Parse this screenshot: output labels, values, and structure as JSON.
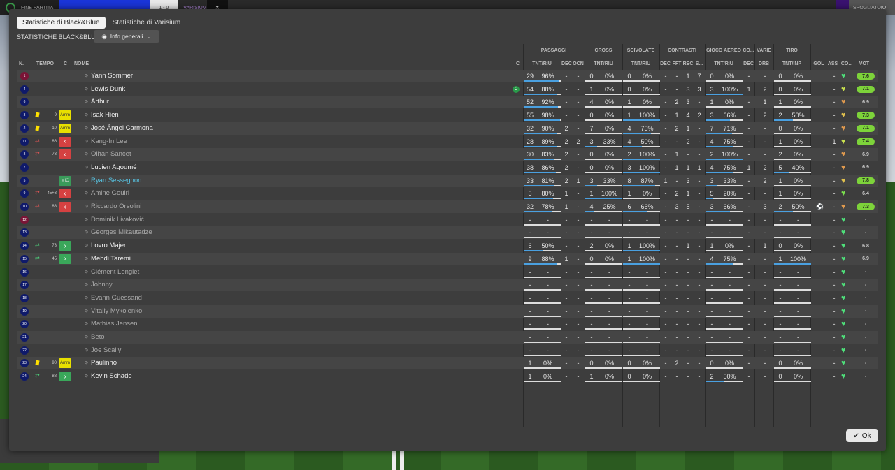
{
  "topbar": {
    "left_label": "FINE PARTITA",
    "score_left": "1 - 0",
    "team_right": "VARISIUM",
    "right_label": "SPOGLIATOIO"
  },
  "tabs": [
    {
      "label": "Statistiche di Black&Blue",
      "active": true
    },
    {
      "label": "Statistiche di Varisium",
      "active": false
    }
  ],
  "subtitle": "STATISTICHE BLACK&BLUE",
  "dropdown": {
    "label": "Info generali"
  },
  "groups": {
    "passaggi": "PASSAGGI",
    "cross": "CROSS",
    "scivolate": "SCIVOLATE",
    "contrasti": "CONTRASTI",
    "gioco_aereo": "GIOCO AEREO",
    "co": "CO...",
    "varie": "VARIE",
    "tiro": "TIRO"
  },
  "columns": {
    "n": "N.",
    "tempo": "TEMPO",
    "c": "C",
    "nome": "NOME",
    "c2": "C",
    "pass": "TNT/RIU",
    "dec": "DEC",
    "ocn": "OCN",
    "cross": "TNT/RIU",
    "sciv": "TNT/RIU",
    "dec2": "DEC",
    "fft": "FFT",
    "rec": "REC",
    "s": "S...",
    "aereo": "TNT/RIU",
    "dec3": "DEC",
    "drb": "DRB",
    "tiro": "TNT/INP",
    "gol": "GOL",
    "ass": "ASS",
    "co2": "CO...",
    "vot": "VOT"
  },
  "players": [
    {
      "num": "1",
      "gk": true,
      "yc": false,
      "swap": "",
      "time": "",
      "role": "",
      "name": "Yann Sommer",
      "dim": false,
      "hl": false,
      "cap": false,
      "pass": "29",
      "passp": "96%",
      "pf": 0.96,
      "dec": "-",
      "ocn": "-",
      "cross": "0",
      "crossp": "0%",
      "cf": 0,
      "sciv": "0",
      "scivp": "0%",
      "sf": 0,
      "cdec": "-",
      "fft": "-",
      "rec": "1",
      "s": "7",
      "aer": "0",
      "aerp": "0%",
      "af": 0,
      "adec": "-",
      "drb": "-",
      "tiro": "0",
      "tirop": "0%",
      "tf": 0,
      "gol": "",
      "ass": "-",
      "heart": "#4ee07a",
      "vot": "7.6",
      "vg": true
    },
    {
      "num": "4",
      "gk": false,
      "yc": false,
      "swap": "",
      "time": "",
      "role": "",
      "name": "Lewis Dunk",
      "dim": false,
      "hl": false,
      "cap": true,
      "pass": "54",
      "passp": "88%",
      "pf": 0.88,
      "dec": "-",
      "ocn": "-",
      "cross": "1",
      "crossp": "0%",
      "cf": 0,
      "sciv": "0",
      "scivp": "0%",
      "sf": 0,
      "cdec": "-",
      "fft": "-",
      "rec": "3",
      "s": "3",
      "aer": "3",
      "aerp": "100%",
      "af": 1,
      "adec": "1",
      "drb": "2",
      "tiro": "0",
      "tirop": "0%",
      "tf": 0,
      "gol": "",
      "ass": "-",
      "heart": "#c8e04e",
      "vot": "7.1",
      "vg": true
    },
    {
      "num": "6",
      "gk": false,
      "yc": false,
      "swap": "",
      "time": "",
      "role": "",
      "name": "Arthur",
      "dim": false,
      "hl": false,
      "cap": false,
      "pass": "52",
      "passp": "92%",
      "pf": 0.92,
      "dec": "-",
      "ocn": "-",
      "cross": "4",
      "crossp": "0%",
      "cf": 0,
      "sciv": "1",
      "scivp": "0%",
      "sf": 0,
      "cdec": "-",
      "fft": "2",
      "rec": "3",
      "s": "-",
      "aer": "1",
      "aerp": "0%",
      "af": 0,
      "adec": "-",
      "drb": "1",
      "tiro": "1",
      "tirop": "0%",
      "tf": 0,
      "gol": "",
      "ass": "-",
      "heart": "#e09a4e",
      "vot": "6.9",
      "vg": false
    },
    {
      "num": "3",
      "gk": false,
      "yc": true,
      "swap": "",
      "time": "9",
      "role": "Amm",
      "name": "Isak Hien",
      "dim": false,
      "hl": false,
      "cap": false,
      "pass": "55",
      "passp": "98%",
      "pf": 0.98,
      "dec": "-",
      "ocn": "-",
      "cross": "0",
      "crossp": "0%",
      "cf": 0,
      "sciv": "1",
      "scivp": "100%",
      "sf": 1,
      "cdec": "-",
      "fft": "1",
      "rec": "4",
      "s": "2",
      "aer": "3",
      "aerp": "66%",
      "af": 0.66,
      "adec": "-",
      "drb": "2",
      "tiro": "2",
      "tirop": "50%",
      "tf": 0.5,
      "gol": "",
      "ass": "-",
      "heart": "#e0c04e",
      "vot": "7.3",
      "vg": true
    },
    {
      "num": "2",
      "gk": false,
      "yc": true,
      "swap": "",
      "time": "10",
      "role": "Amm",
      "name": "José Ángel Carmona",
      "dim": false,
      "hl": false,
      "cap": false,
      "pass": "32",
      "passp": "90%",
      "pf": 0.9,
      "dec": "2",
      "ocn": "-",
      "cross": "7",
      "crossp": "0%",
      "cf": 0,
      "sciv": "4",
      "scivp": "75%",
      "sf": 0.75,
      "cdec": "-",
      "fft": "2",
      "rec": "1",
      "s": "-",
      "aer": "7",
      "aerp": "71%",
      "af": 0.71,
      "adec": "-",
      "drb": "-",
      "tiro": "0",
      "tirop": "0%",
      "tf": 0,
      "gol": "",
      "ass": "-",
      "heart": "#e09a4e",
      "vot": "7.1",
      "vg": true
    },
    {
      "num": "11",
      "gk": false,
      "yc": false,
      "swap": "r",
      "time": "86",
      "role": "out",
      "name": "Kang-In Lee",
      "dim": true,
      "hl": false,
      "cap": false,
      "pass": "28",
      "passp": "89%",
      "pf": 0.89,
      "dec": "2",
      "ocn": "2",
      "cross": "3",
      "crossp": "33%",
      "cf": 0.33,
      "sciv": "4",
      "scivp": "50%",
      "sf": 0.5,
      "cdec": "-",
      "fft": "-",
      "rec": "2",
      "s": "-",
      "aer": "4",
      "aerp": "75%",
      "af": 0.75,
      "adec": "-",
      "drb": "-",
      "tiro": "1",
      "tirop": "0%",
      "tf": 0,
      "gol": "",
      "ass": "1",
      "heart": "#c8e04e",
      "vot": "7.4",
      "vg": true
    },
    {
      "num": "8",
      "gk": false,
      "yc": false,
      "swap": "r",
      "time": "73",
      "role": "out",
      "name": "Oihan Sancet",
      "dim": true,
      "hl": false,
      "cap": false,
      "pass": "30",
      "passp": "83%",
      "pf": 0.83,
      "dec": "2",
      "ocn": "-",
      "cross": "0",
      "crossp": "0%",
      "cf": 0,
      "sciv": "2",
      "scivp": "100%",
      "sf": 1,
      "cdec": "-",
      "fft": "1",
      "rec": "-",
      "s": "-",
      "aer": "2",
      "aerp": "100%",
      "af": 1,
      "adec": "-",
      "drb": "-",
      "tiro": "2",
      "tirop": "0%",
      "tf": 0,
      "gol": "",
      "ass": "-",
      "heart": "#e09a4e",
      "vot": "6.9",
      "vg": false
    },
    {
      "num": "7",
      "gk": false,
      "yc": false,
      "swap": "",
      "time": "",
      "role": "",
      "name": "Lucien Agoumé",
      "dim": false,
      "hl": false,
      "cap": false,
      "pass": "38",
      "passp": "86%",
      "pf": 0.86,
      "dec": "2",
      "ocn": "-",
      "cross": "0",
      "crossp": "0%",
      "cf": 0,
      "sciv": "3",
      "scivp": "100%",
      "sf": 1,
      "cdec": "-",
      "fft": "1",
      "rec": "1",
      "s": "1",
      "aer": "4",
      "aerp": "75%",
      "af": 0.75,
      "adec": "1",
      "drb": "2",
      "tiro": "5",
      "tirop": "40%",
      "tf": 0.4,
      "gol": "",
      "ass": "-",
      "heart": "#e09a4e",
      "vot": "6.9",
      "vg": false
    },
    {
      "num": "5",
      "gk": false,
      "yc": false,
      "swap": "",
      "time": "",
      "role": "MIC",
      "name": "Ryan Sessegnon",
      "dim": false,
      "hl": true,
      "cap": false,
      "pass": "33",
      "passp": "81%",
      "pf": 0.81,
      "dec": "2",
      "ocn": "1",
      "cross": "3",
      "crossp": "33%",
      "cf": 0.33,
      "sciv": "8",
      "scivp": "87%",
      "sf": 0.87,
      "cdec": "1",
      "fft": "-",
      "rec": "3",
      "s": "-",
      "aer": "3",
      "aerp": "33%",
      "af": 0.33,
      "adec": "-",
      "drb": "2",
      "tiro": "1",
      "tirop": "0%",
      "tf": 0,
      "gol": "",
      "ass": "-",
      "heart": "#e0c04e",
      "vot": "7.8",
      "vg": true
    },
    {
      "num": "9",
      "gk": false,
      "yc": false,
      "swap": "r",
      "time": "45+3",
      "role": "out",
      "name": "Amine Gouiri",
      "dim": true,
      "hl": false,
      "cap": false,
      "pass": "5",
      "passp": "80%",
      "pf": 0.8,
      "dec": "1",
      "ocn": "-",
      "cross": "1",
      "crossp": "100%",
      "cf": 1,
      "sciv": "1",
      "scivp": "0%",
      "sf": 0,
      "cdec": "-",
      "fft": "2",
      "rec": "1",
      "s": "-",
      "aer": "5",
      "aerp": "20%",
      "af": 0.2,
      "adec": "-",
      "drb": "-",
      "tiro": "1",
      "tirop": "0%",
      "tf": 0,
      "gol": "",
      "ass": "-",
      "heart": "#7ae04e",
      "vot": "6.4",
      "vg": false
    },
    {
      "num": "10",
      "gk": false,
      "yc": false,
      "swap": "r",
      "time": "88",
      "role": "out",
      "name": "Riccardo Orsolini",
      "dim": true,
      "hl": false,
      "cap": false,
      "pass": "32",
      "passp": "78%",
      "pf": 0.78,
      "dec": "1",
      "ocn": "-",
      "cross": "4",
      "crossp": "25%",
      "cf": 0.25,
      "sciv": "6",
      "scivp": "66%",
      "sf": 0.66,
      "cdec": "-",
      "fft": "3",
      "rec": "5",
      "s": "-",
      "aer": "3",
      "aerp": "66%",
      "af": 0.66,
      "adec": "-",
      "drb": "3",
      "tiro": "2",
      "tirop": "50%",
      "tf": 0.5,
      "gol": "⚽",
      "ass": "-",
      "heart": "#e09a4e",
      "vot": "7.3",
      "vg": true
    },
    {
      "num": "12",
      "gk": true,
      "yc": false,
      "swap": "",
      "time": "",
      "role": "",
      "name": "Dominik Livaković",
      "dim": true,
      "hl": false,
      "cap": false,
      "pass": "-",
      "passp": "-",
      "pf": 0,
      "dec": "-",
      "ocn": "-",
      "cross": "-",
      "crossp": "-",
      "cf": 0,
      "sciv": "-",
      "scivp": "-",
      "sf": 0,
      "cdec": "-",
      "fft": "-",
      "rec": "-",
      "s": "-",
      "aer": "-",
      "aerp": "-",
      "af": 0,
      "adec": "-",
      "drb": "-",
      "tiro": "-",
      "tirop": "-",
      "tf": 0,
      "gol": "",
      "ass": "-",
      "heart": "#4ee07a",
      "vot": "-",
      "vg": false
    },
    {
      "num": "13",
      "gk": false,
      "yc": false,
      "swap": "",
      "time": "",
      "role": "",
      "name": "Georges Mikautadze",
      "dim": true,
      "hl": false,
      "cap": false,
      "pass": "-",
      "passp": "-",
      "pf": 0,
      "dec": "-",
      "ocn": "-",
      "cross": "-",
      "crossp": "-",
      "cf": 0,
      "sciv": "-",
      "scivp": "-",
      "sf": 0,
      "cdec": "-",
      "fft": "-",
      "rec": "-",
      "s": "-",
      "aer": "-",
      "aerp": "-",
      "af": 0,
      "adec": "-",
      "drb": "-",
      "tiro": "-",
      "tirop": "-",
      "tf": 0,
      "gol": "",
      "ass": "-",
      "heart": "#4ee07a",
      "vot": "-",
      "vg": false
    },
    {
      "num": "14",
      "gk": false,
      "yc": false,
      "swap": "g",
      "time": "73",
      "role": "in",
      "name": "Lovro Majer",
      "dim": false,
      "hl": false,
      "cap": false,
      "pass": "6",
      "passp": "50%",
      "pf": 0.5,
      "dec": "-",
      "ocn": "-",
      "cross": "2",
      "crossp": "0%",
      "cf": 0,
      "sciv": "1",
      "scivp": "100%",
      "sf": 1,
      "cdec": "-",
      "fft": "-",
      "rec": "1",
      "s": "-",
      "aer": "1",
      "aerp": "0%",
      "af": 0,
      "adec": "-",
      "drb": "1",
      "tiro": "0",
      "tirop": "0%",
      "tf": 0,
      "gol": "",
      "ass": "-",
      "heart": "#4ee07a",
      "vot": "6.8",
      "vg": false
    },
    {
      "num": "15",
      "gk": false,
      "yc": false,
      "swap": "g",
      "time": "45",
      "role": "in",
      "name": "Mehdi Taremi",
      "dim": false,
      "hl": false,
      "cap": false,
      "pass": "9",
      "passp": "88%",
      "pf": 0.88,
      "dec": "1",
      "ocn": "-",
      "cross": "0",
      "crossp": "0%",
      "cf": 0,
      "sciv": "1",
      "scivp": "100%",
      "sf": 1,
      "cdec": "-",
      "fft": "-",
      "rec": "-",
      "s": "-",
      "aer": "4",
      "aerp": "75%",
      "af": 0.75,
      "adec": "-",
      "drb": "-",
      "tiro": "1",
      "tirop": "100%",
      "tf": 1,
      "gol": "",
      "ass": "-",
      "heart": "#4ee07a",
      "vot": "6.9",
      "vg": false
    },
    {
      "num": "16",
      "gk": false,
      "yc": false,
      "swap": "",
      "time": "",
      "role": "",
      "name": "Clément Lenglet",
      "dim": true,
      "hl": false,
      "cap": false,
      "pass": "-",
      "passp": "-",
      "pf": 0,
      "dec": "-",
      "ocn": "-",
      "cross": "-",
      "crossp": "-",
      "cf": 0,
      "sciv": "-",
      "scivp": "-",
      "sf": 0,
      "cdec": "-",
      "fft": "-",
      "rec": "-",
      "s": "-",
      "aer": "-",
      "aerp": "-",
      "af": 0,
      "adec": "-",
      "drb": "-",
      "tiro": "-",
      "tirop": "-",
      "tf": 0,
      "gol": "",
      "ass": "-",
      "heart": "#4ee07a",
      "vot": "-",
      "vg": false
    },
    {
      "num": "17",
      "gk": false,
      "yc": false,
      "swap": "",
      "time": "",
      "role": "",
      "name": "Johnny",
      "dim": true,
      "hl": false,
      "cap": false,
      "pass": "-",
      "passp": "-",
      "pf": 0,
      "dec": "-",
      "ocn": "-",
      "cross": "-",
      "crossp": "-",
      "cf": 0,
      "sciv": "-",
      "scivp": "-",
      "sf": 0,
      "cdec": "-",
      "fft": "-",
      "rec": "-",
      "s": "-",
      "aer": "-",
      "aerp": "-",
      "af": 0,
      "adec": "-",
      "drb": "-",
      "tiro": "-",
      "tirop": "-",
      "tf": 0,
      "gol": "",
      "ass": "-",
      "heart": "#4ee07a",
      "vot": "-",
      "vg": false
    },
    {
      "num": "18",
      "gk": false,
      "yc": false,
      "swap": "",
      "time": "",
      "role": "",
      "name": "Evann Guessand",
      "dim": true,
      "hl": false,
      "cap": false,
      "pass": "-",
      "passp": "-",
      "pf": 0,
      "dec": "-",
      "ocn": "-",
      "cross": "-",
      "crossp": "-",
      "cf": 0,
      "sciv": "-",
      "scivp": "-",
      "sf": 0,
      "cdec": "-",
      "fft": "-",
      "rec": "-",
      "s": "-",
      "aer": "-",
      "aerp": "-",
      "af": 0,
      "adec": "-",
      "drb": "-",
      "tiro": "-",
      "tirop": "-",
      "tf": 0,
      "gol": "",
      "ass": "-",
      "heart": "#4ee07a",
      "vot": "-",
      "vg": false
    },
    {
      "num": "19",
      "gk": false,
      "yc": false,
      "swap": "",
      "time": "",
      "role": "",
      "name": "Vitaliy Mykolenko",
      "dim": true,
      "hl": false,
      "cap": false,
      "pass": "-",
      "passp": "-",
      "pf": 0,
      "dec": "-",
      "ocn": "-",
      "cross": "-",
      "crossp": "-",
      "cf": 0,
      "sciv": "-",
      "scivp": "-",
      "sf": 0,
      "cdec": "-",
      "fft": "-",
      "rec": "-",
      "s": "-",
      "aer": "-",
      "aerp": "-",
      "af": 0,
      "adec": "-",
      "drb": "-",
      "tiro": "-",
      "tirop": "-",
      "tf": 0,
      "gol": "",
      "ass": "-",
      "heart": "#4ee07a",
      "vot": "-",
      "vg": false
    },
    {
      "num": "20",
      "gk": false,
      "yc": false,
      "swap": "",
      "time": "",
      "role": "",
      "name": "Mathias Jensen",
      "dim": true,
      "hl": false,
      "cap": false,
      "pass": "-",
      "passp": "-",
      "pf": 0,
      "dec": "-",
      "ocn": "-",
      "cross": "-",
      "crossp": "-",
      "cf": 0,
      "sciv": "-",
      "scivp": "-",
      "sf": 0,
      "cdec": "-",
      "fft": "-",
      "rec": "-",
      "s": "-",
      "aer": "-",
      "aerp": "-",
      "af": 0,
      "adec": "-",
      "drb": "-",
      "tiro": "-",
      "tirop": "-",
      "tf": 0,
      "gol": "",
      "ass": "-",
      "heart": "#4ee07a",
      "vot": "-",
      "vg": false
    },
    {
      "num": "21",
      "gk": false,
      "yc": false,
      "swap": "",
      "time": "",
      "role": "",
      "name": "Beto",
      "dim": true,
      "hl": false,
      "cap": false,
      "pass": "-",
      "passp": "-",
      "pf": 0,
      "dec": "-",
      "ocn": "-",
      "cross": "-",
      "crossp": "-",
      "cf": 0,
      "sciv": "-",
      "scivp": "-",
      "sf": 0,
      "cdec": "-",
      "fft": "-",
      "rec": "-",
      "s": "-",
      "aer": "-",
      "aerp": "-",
      "af": 0,
      "adec": "-",
      "drb": "-",
      "tiro": "-",
      "tirop": "-",
      "tf": 0,
      "gol": "",
      "ass": "-",
      "heart": "#4ee07a",
      "vot": "-",
      "vg": false
    },
    {
      "num": "22",
      "gk": false,
      "yc": false,
      "swap": "",
      "time": "",
      "role": "",
      "name": "Joe Scally",
      "dim": true,
      "hl": false,
      "cap": false,
      "pass": "-",
      "passp": "-",
      "pf": 0,
      "dec": "-",
      "ocn": "-",
      "cross": "-",
      "crossp": "-",
      "cf": 0,
      "sciv": "-",
      "scivp": "-",
      "sf": 0,
      "cdec": "-",
      "fft": "-",
      "rec": "-",
      "s": "-",
      "aer": "-",
      "aerp": "-",
      "af": 0,
      "adec": "-",
      "drb": "-",
      "tiro": "-",
      "tirop": "-",
      "tf": 0,
      "gol": "",
      "ass": "-",
      "heart": "#4ee07a",
      "vot": "-",
      "vg": false
    },
    {
      "num": "23",
      "gk": false,
      "yc": true,
      "swap": "",
      "time": "90",
      "role": "Amm",
      "name": "Paulinho",
      "dim": false,
      "hl": false,
      "cap": false,
      "pass": "1",
      "passp": "0%",
      "pf": 0,
      "dec": "-",
      "ocn": "-",
      "cross": "0",
      "crossp": "0%",
      "cf": 0,
      "sciv": "0",
      "scivp": "0%",
      "sf": 0,
      "cdec": "-",
      "fft": "2",
      "rec": "-",
      "s": "-",
      "aer": "0",
      "aerp": "0%",
      "af": 0,
      "adec": "-",
      "drb": "-",
      "tiro": "0",
      "tirop": "0%",
      "tf": 0,
      "gol": "",
      "ass": "-",
      "heart": "#4ee07a",
      "vot": "-",
      "vg": false
    },
    {
      "num": "24",
      "gk": false,
      "yc": false,
      "swap": "g",
      "time": "88",
      "role": "in",
      "name": "Kevin Schade",
      "dim": false,
      "hl": false,
      "cap": false,
      "pass": "1",
      "passp": "0%",
      "pf": 0,
      "dec": "-",
      "ocn": "-",
      "cross": "1",
      "crossp": "0%",
      "cf": 0,
      "sciv": "0",
      "scivp": "0%",
      "sf": 0,
      "cdec": "-",
      "fft": "-",
      "rec": "-",
      "s": "-",
      "aer": "2",
      "aerp": "50%",
      "af": 0.5,
      "adec": "-",
      "drb": "-",
      "tiro": "0",
      "tirop": "0%",
      "tf": 0,
      "gol": "",
      "ass": "-",
      "heart": "#4ee07a",
      "vot": "-",
      "vg": false
    }
  ],
  "ok_label": "Ok"
}
